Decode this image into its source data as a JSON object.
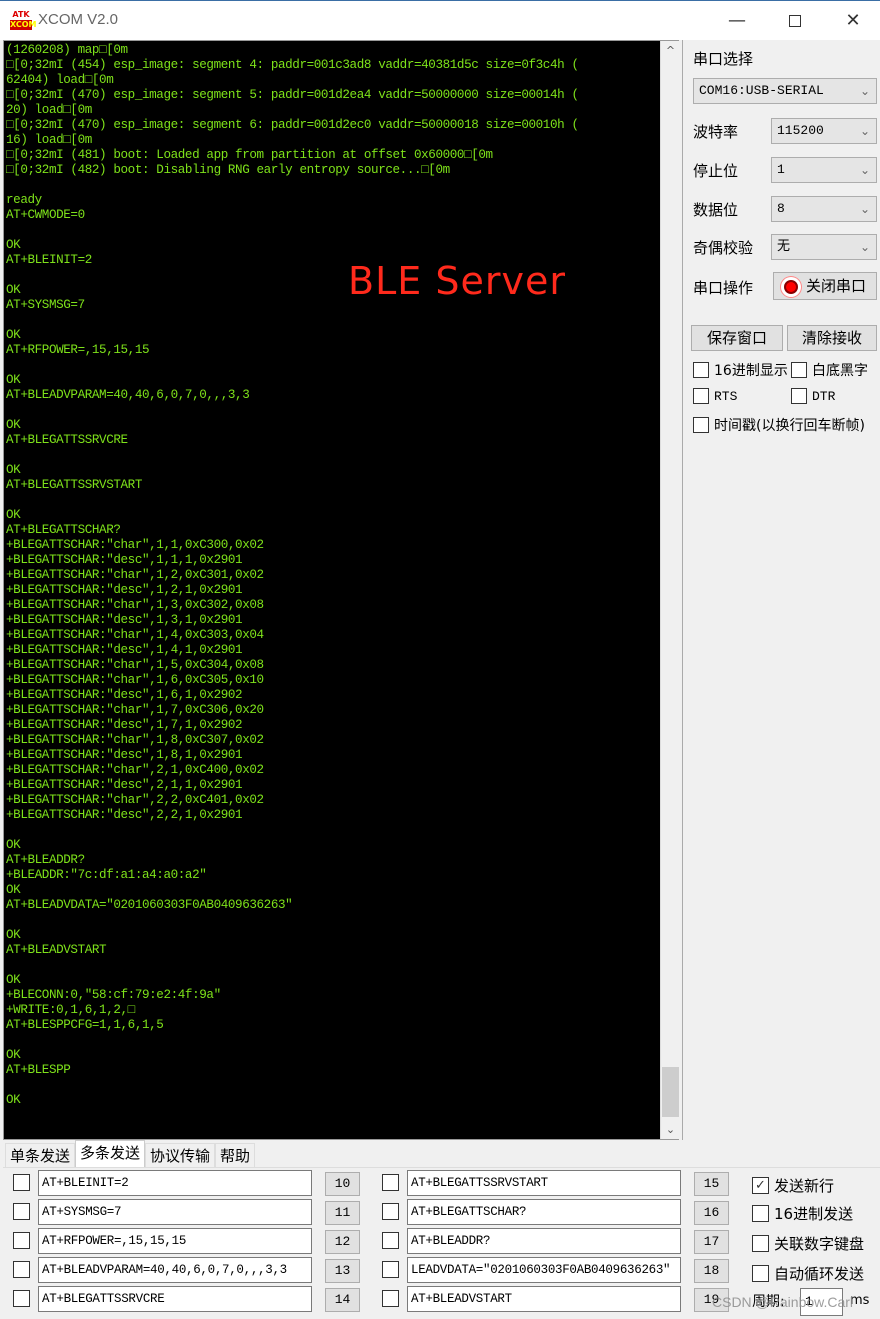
{
  "window": {
    "logo_top": "ATK",
    "logo_bottom": "XCOM",
    "title": "XCOM V2.0",
    "min_icon": "—",
    "close_icon": "✕"
  },
  "terminal": {
    "overlay_label": "BLE  Server",
    "lines": [
      "(1260208) map□[0m",
      "□[0;32mI (454) esp_image: segment 4: paddr=001c3ad8 vaddr=40381d5c size=0f3c4h (",
      "62404) load□[0m",
      "□[0;32mI (470) esp_image: segment 5: paddr=001d2ea4 vaddr=50000000 size=00014h (",
      "20) load□[0m",
      "□[0;32mI (470) esp_image: segment 6: paddr=001d2ec0 vaddr=50000018 size=00010h (",
      "16) load□[0m",
      "□[0;32mI (481) boot: Loaded app from partition at offset 0x60000□[0m",
      "□[0;32mI (482) boot: Disabling RNG early entropy source...□[0m",
      "",
      "ready",
      "AT+CWMODE=0",
      "",
      "OK",
      "AT+BLEINIT=2",
      "",
      "OK",
      "AT+SYSMSG=7",
      "",
      "OK",
      "AT+RFPOWER=,15,15,15",
      "",
      "OK",
      "AT+BLEADVPARAM=40,40,6,0,7,0,,,3,3",
      "",
      "OK",
      "AT+BLEGATTSSRVCRE",
      "",
      "OK",
      "AT+BLEGATTSSRVSTART",
      "",
      "OK",
      "AT+BLEGATTSCHAR?",
      "+BLEGATTSCHAR:\"char\",1,1,0xC300,0x02",
      "+BLEGATTSCHAR:\"desc\",1,1,1,0x2901",
      "+BLEGATTSCHAR:\"char\",1,2,0xC301,0x02",
      "+BLEGATTSCHAR:\"desc\",1,2,1,0x2901",
      "+BLEGATTSCHAR:\"char\",1,3,0xC302,0x08",
      "+BLEGATTSCHAR:\"desc\",1,3,1,0x2901",
      "+BLEGATTSCHAR:\"char\",1,4,0xC303,0x04",
      "+BLEGATTSCHAR:\"desc\",1,4,1,0x2901",
      "+BLEGATTSCHAR:\"char\",1,5,0xC304,0x08",
      "+BLEGATTSCHAR:\"char\",1,6,0xC305,0x10",
      "+BLEGATTSCHAR:\"desc\",1,6,1,0x2902",
      "+BLEGATTSCHAR:\"char\",1,7,0xC306,0x20",
      "+BLEGATTSCHAR:\"desc\",1,7,1,0x2902",
      "+BLEGATTSCHAR:\"char\",1,8,0xC307,0x02",
      "+BLEGATTSCHAR:\"desc\",1,8,1,0x2901",
      "+BLEGATTSCHAR:\"char\",2,1,0xC400,0x02",
      "+BLEGATTSCHAR:\"desc\",2,1,1,0x2901",
      "+BLEGATTSCHAR:\"char\",2,2,0xC401,0x02",
      "+BLEGATTSCHAR:\"desc\",2,2,1,0x2901",
      "",
      "OK",
      "AT+BLEADDR?",
      "+BLEADDR:\"7c:df:a1:a4:a0:a2\"",
      "OK",
      "AT+BLEADVDATA=\"0201060303F0AB0409636263\"",
      "",
      "OK",
      "AT+BLEADVSTART",
      "",
      "OK",
      "+BLECONN:0,\"58:cf:79:e2:4f:9a\"",
      "+WRITE:0,1,6,1,2,□",
      "AT+BLESPPCFG=1,1,6,1,5",
      "",
      "OK",
      "AT+BLESPP",
      "",
      "OK",
      "",
      "",
      ">"
    ]
  },
  "settings": {
    "port_label": "串口选择",
    "port_value": "COM16:USB-SERIAL",
    "baud_label": "波特率",
    "baud_value": "115200",
    "stop_label": "停止位",
    "stop_value": "1",
    "data_label": "数据位",
    "data_value": "8",
    "parity_label": "奇偶校验",
    "parity_value": "无",
    "op_label": "串口操作",
    "close_port_button": "关闭串口",
    "save_window_button": "保存窗口",
    "clear_receive_button": "清除接收",
    "hex_display": {
      "label": "16进制显示",
      "checked": false
    },
    "white_bg": {
      "label": "白底黑字",
      "checked": false
    },
    "rts": {
      "label": "RTS",
      "checked": false
    },
    "dtr": {
      "label": "DTR",
      "checked": false
    },
    "timestamp": {
      "label": "时间戳(以换行回车断帧)",
      "checked": false
    }
  },
  "tabs": [
    {
      "label": "单条发送",
      "active": false
    },
    {
      "label": "多条发送",
      "active": true
    },
    {
      "label": "协议传输",
      "active": false
    },
    {
      "label": "帮助",
      "active": false
    }
  ],
  "multi_send": {
    "rows": [
      {
        "checked": false,
        "value": "AT+BLEINIT=2",
        "button": "10"
      },
      {
        "checked": false,
        "value": "AT+SYSMSG=7",
        "button": "11"
      },
      {
        "checked": false,
        "value": "AT+RFPOWER=,15,15,15",
        "button": "12"
      },
      {
        "checked": false,
        "value": "AT+BLEADVPARAM=40,40,6,0,7,0,,,3,3",
        "button": "13"
      },
      {
        "checked": false,
        "value": "AT+BLEGATTSSRVCRE",
        "button": "14"
      },
      {
        "checked": false,
        "value": "AT+BLEGATTSSRVSTART",
        "button": "15"
      },
      {
        "checked": false,
        "value": "AT+BLEGATTSCHAR?",
        "button": "16"
      },
      {
        "checked": false,
        "value": "AT+BLEADDR?",
        "button": "17"
      },
      {
        "checked": false,
        "value": "LEADVDATA=\"0201060303F0AB0409636263\"",
        "button": "18"
      },
      {
        "checked": false,
        "value": "AT+BLEADVSTART",
        "button": "19"
      }
    ],
    "options": [
      {
        "label": "发送新行",
        "checked": true
      },
      {
        "label": "16进制发送",
        "checked": false
      },
      {
        "label": "关联数字键盘",
        "checked": false
      },
      {
        "label": "自动循环发送",
        "checked": false
      }
    ],
    "period_label": "周期:",
    "period_value": "1",
    "period_unit": "ms"
  },
  "watermark": "CSDN @Rainbow.Carl"
}
